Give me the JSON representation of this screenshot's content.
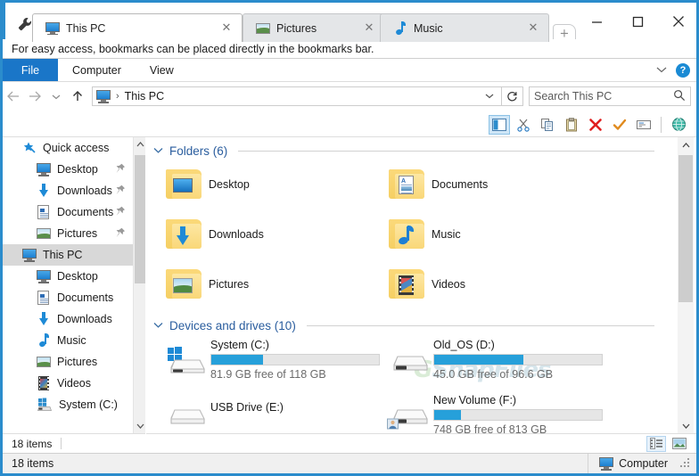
{
  "window": {
    "wrench_icon": "wrench-icon",
    "controls": {
      "minimize": "—",
      "maximize": "□",
      "close": "✕"
    }
  },
  "tabs": [
    {
      "label": "This PC",
      "icon": "monitor-icon",
      "active": true,
      "close": "✕"
    },
    {
      "label": "Pictures",
      "icon": "picture-icon",
      "active": false,
      "close": "✕"
    },
    {
      "label": "Music",
      "icon": "music-note-icon",
      "active": false,
      "close": "✕"
    }
  ],
  "new_tab": {
    "label": "+",
    "icon": "plus-icon"
  },
  "bookmark_bar": {
    "message": "For easy access, bookmarks can be placed directly in the bookmarks bar."
  },
  "ribbon": {
    "file_label": "File",
    "tabs": [
      "Computer",
      "View"
    ],
    "expand_icon": "chevron-down-icon",
    "help_label": "?"
  },
  "address_bar": {
    "back_icon": "←",
    "forward_icon": "→",
    "recent_icon": "⌄",
    "up_icon": "↑",
    "path_icon": "monitor-icon",
    "separator": "›",
    "path": "This PC",
    "dropdown_icon": "⌄",
    "refresh_icon": "↻"
  },
  "search": {
    "placeholder": "Search This PC",
    "icon": "search-icon"
  },
  "toolbar": {
    "buttons": [
      {
        "name": "navigation-pane-toggle",
        "icon": "pane-icon",
        "selected": true
      },
      {
        "name": "cut-button",
        "icon": "scissors-icon",
        "selected": false
      },
      {
        "name": "copy-button",
        "icon": "copy-icon",
        "selected": false
      },
      {
        "name": "paste-button",
        "icon": "clipboard-icon",
        "selected": false
      },
      {
        "name": "delete-button",
        "icon": "red-x-icon",
        "selected": false
      },
      {
        "name": "confirm-button",
        "icon": "orange-check-icon",
        "selected": false
      },
      {
        "name": "rename-button",
        "icon": "rename-icon",
        "selected": false
      },
      {
        "name": "network-button",
        "icon": "globe-icon",
        "selected": false
      }
    ]
  },
  "sidebar": {
    "items": [
      {
        "label": "Quick access",
        "icon": "star-pin-icon",
        "indent": 0,
        "pinned": false,
        "selected": false
      },
      {
        "label": "Desktop",
        "icon": "monitor-icon",
        "indent": 1,
        "pinned": true,
        "selected": false
      },
      {
        "label": "Downloads",
        "icon": "download-arrow-icon",
        "indent": 1,
        "pinned": true,
        "selected": false
      },
      {
        "label": "Documents",
        "icon": "document-icon",
        "indent": 1,
        "pinned": true,
        "selected": false
      },
      {
        "label": "Pictures",
        "icon": "picture-icon",
        "indent": 1,
        "pinned": true,
        "selected": false
      },
      {
        "label": "This PC",
        "icon": "monitor-icon",
        "indent": 0,
        "pinned": false,
        "selected": true
      },
      {
        "label": "Desktop",
        "icon": "monitor-icon",
        "indent": 1,
        "pinned": false,
        "selected": false
      },
      {
        "label": "Documents",
        "icon": "document-icon",
        "indent": 1,
        "pinned": false,
        "selected": false
      },
      {
        "label": "Downloads",
        "icon": "download-arrow-icon",
        "indent": 1,
        "pinned": false,
        "selected": false
      },
      {
        "label": "Music",
        "icon": "music-note-icon",
        "indent": 1,
        "pinned": false,
        "selected": false
      },
      {
        "label": "Pictures",
        "icon": "picture-icon",
        "indent": 1,
        "pinned": false,
        "selected": false
      },
      {
        "label": "Videos",
        "icon": "video-icon",
        "indent": 1,
        "pinned": false,
        "selected": false
      },
      {
        "label": "System (C:)",
        "icon": "drive-windows-icon",
        "indent": 1,
        "pinned": false,
        "selected": false
      }
    ],
    "scroll_up_icon": "⌃",
    "scroll_down_icon": "⌄",
    "item_count": "18 items"
  },
  "content": {
    "groups": [
      {
        "chevron": "⌄",
        "title": "Folders (6)"
      },
      {
        "chevron": "⌄",
        "title": "Devices and drives (10)"
      }
    ],
    "folders": [
      {
        "label": "Desktop",
        "emblem": "desktop-emblem",
        "col": 0,
        "row": 0
      },
      {
        "label": "Documents",
        "emblem": "document-emblem",
        "col": 1,
        "row": 0
      },
      {
        "label": "Downloads",
        "emblem": "download-emblem",
        "col": 0,
        "row": 1
      },
      {
        "label": "Music",
        "emblem": "music-emblem",
        "col": 1,
        "row": 1
      },
      {
        "label": "Pictures",
        "emblem": "picture-emblem",
        "col": 0,
        "row": 2
      },
      {
        "label": "Videos",
        "emblem": "video-emblem",
        "col": 1,
        "row": 2
      }
    ],
    "drives": [
      {
        "name": "System (C:)",
        "free_text": "81.9 GB free of 118 GB",
        "used_pct": 31,
        "has_bar": true,
        "icon": "drive-windows-icon",
        "col": 0,
        "row": 0
      },
      {
        "name": "Old_OS (D:)",
        "free_text": "45.0 GB free of 96.6 GB",
        "used_pct": 53,
        "has_bar": true,
        "icon": "drive-icon",
        "col": 1,
        "row": 0
      },
      {
        "name": "New Volume (F:)",
        "free_text": "748 GB free of 813 GB",
        "used_pct": 16,
        "has_bar": true,
        "icon": "drive-shared-icon",
        "col": 1,
        "row": 1
      },
      {
        "name": "USB Drive (E:)",
        "free_text": "",
        "used_pct": 0,
        "has_bar": false,
        "icon": "drive-icon",
        "col": 0,
        "row": 1
      }
    ],
    "watermark": {
      "prefix": "G",
      "text": "SnapFiles"
    },
    "scroll_up_icon": "⌃",
    "scroll_down_icon": "⌄"
  },
  "inner_status": {
    "view_buttons": [
      {
        "name": "details-view-button",
        "icon": "details-view-icon",
        "selected": true
      },
      {
        "name": "large-icons-view-button",
        "icon": "large-icons-view-icon",
        "selected": false
      }
    ]
  },
  "status_bar": {
    "item_count": "18 items",
    "location_label": "Computer",
    "location_icon": "monitor-icon",
    "grip_icon": "resize-grip-icon"
  },
  "colors": {
    "window_border": "#2b8ccc",
    "file_tab": "#1a76c8",
    "group_header": "#2a5d9e",
    "progress_fill": "#26a0da",
    "selection": "#d8d8d8"
  }
}
